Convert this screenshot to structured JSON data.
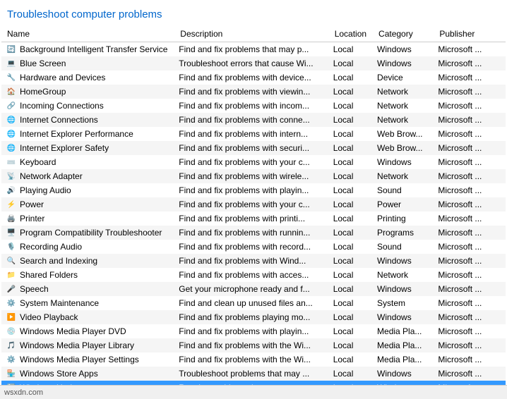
{
  "title": "Troubleshoot computer problems",
  "columns": [
    {
      "key": "name",
      "label": "Name"
    },
    {
      "key": "description",
      "label": "Description"
    },
    {
      "key": "location",
      "label": "Location"
    },
    {
      "key": "category",
      "label": "Category"
    },
    {
      "key": "publisher",
      "label": "Publisher"
    }
  ],
  "rows": [
    {
      "name": "Background Intelligent Transfer Service",
      "description": "Find and fix problems that may p...",
      "location": "Local",
      "category": "Windows",
      "publisher": "Microsoft ...",
      "icon": "bits",
      "selected": false
    },
    {
      "name": "Blue Screen",
      "description": "Troubleshoot errors that cause Wi...",
      "location": "Local",
      "category": "Windows",
      "publisher": "Microsoft ...",
      "icon": "bsod",
      "selected": false
    },
    {
      "name": "Hardware and Devices",
      "description": "Find and fix problems with device...",
      "location": "Local",
      "category": "Device",
      "publisher": "Microsoft ...",
      "icon": "hw",
      "selected": false
    },
    {
      "name": "HomeGroup",
      "description": "Find and fix problems with viewin...",
      "location": "Local",
      "category": "Network",
      "publisher": "Microsoft ...",
      "icon": "hg",
      "selected": false
    },
    {
      "name": "Incoming Connections",
      "description": "Find and fix problems with incom...",
      "location": "Local",
      "category": "Network",
      "publisher": "Microsoft ...",
      "icon": "ic",
      "selected": false
    },
    {
      "name": "Internet Connections",
      "description": "Find and fix problems with conne...",
      "location": "Local",
      "category": "Network",
      "publisher": "Microsoft ...",
      "icon": "inet",
      "selected": false
    },
    {
      "name": "Internet Explorer Performance",
      "description": "Find and fix problems with intern...",
      "location": "Local",
      "category": "Web Brow...",
      "publisher": "Microsoft ...",
      "icon": "ie",
      "selected": false
    },
    {
      "name": "Internet Explorer Safety",
      "description": "Find and fix problems with securi...",
      "location": "Local",
      "category": "Web Brow...",
      "publisher": "Microsoft ...",
      "icon": "ie",
      "selected": false
    },
    {
      "name": "Keyboard",
      "description": "Find and fix problems with your c...",
      "location": "Local",
      "category": "Windows",
      "publisher": "Microsoft ...",
      "icon": "key",
      "selected": false
    },
    {
      "name": "Network Adapter",
      "description": "Find and fix problems with wirele...",
      "location": "Local",
      "category": "Network",
      "publisher": "Microsoft ...",
      "icon": "net",
      "selected": false
    },
    {
      "name": "Playing Audio",
      "description": "Find and fix problems with playin...",
      "location": "Local",
      "category": "Sound",
      "publisher": "Microsoft ...",
      "icon": "audio",
      "selected": false
    },
    {
      "name": "Power",
      "description": "Find and fix problems with your c...",
      "location": "Local",
      "category": "Power",
      "publisher": "Microsoft ...",
      "icon": "power",
      "selected": false
    },
    {
      "name": "Printer",
      "description": "Find and fix problems with printi...",
      "location": "Local",
      "category": "Printing",
      "publisher": "Microsoft ...",
      "icon": "print",
      "selected": false
    },
    {
      "name": "Program Compatibility Troubleshooter",
      "description": "Find and fix problems with runnin...",
      "location": "Local",
      "category": "Programs",
      "publisher": "Microsoft ...",
      "icon": "compat",
      "selected": false
    },
    {
      "name": "Recording Audio",
      "description": "Find and fix problems with record...",
      "location": "Local",
      "category": "Sound",
      "publisher": "Microsoft ...",
      "icon": "rec",
      "selected": false
    },
    {
      "name": "Search and Indexing",
      "description": "Find and fix problems with Wind...",
      "location": "Local",
      "category": "Windows",
      "publisher": "Microsoft ...",
      "icon": "search",
      "selected": false
    },
    {
      "name": "Shared Folders",
      "description": "Find and fix problems with acces...",
      "location": "Local",
      "category": "Network",
      "publisher": "Microsoft ...",
      "icon": "shared",
      "selected": false
    },
    {
      "name": "Speech",
      "description": "Get your microphone ready and f...",
      "location": "Local",
      "category": "Windows",
      "publisher": "Microsoft ...",
      "icon": "speech",
      "selected": false
    },
    {
      "name": "System Maintenance",
      "description": "Find and clean up unused files an...",
      "location": "Local",
      "category": "System",
      "publisher": "Microsoft ...",
      "icon": "sys",
      "selected": false
    },
    {
      "name": "Video Playback",
      "description": "Find and fix problems playing mo...",
      "location": "Local",
      "category": "Windows",
      "publisher": "Microsoft ...",
      "icon": "video",
      "selected": false
    },
    {
      "name": "Windows Media Player DVD",
      "description": "Find and fix problems with playin...",
      "location": "Local",
      "category": "Media Pla...",
      "publisher": "Microsoft ...",
      "icon": "dvd",
      "selected": false
    },
    {
      "name": "Windows Media Player Library",
      "description": "Find and fix problems with the Wi...",
      "location": "Local",
      "category": "Media Pla...",
      "publisher": "Microsoft ...",
      "icon": "wmp",
      "selected": false
    },
    {
      "name": "Windows Media Player Settings",
      "description": "Find and fix problems with the Wi...",
      "location": "Local",
      "category": "Media Pla...",
      "publisher": "Microsoft ...",
      "icon": "wmpset",
      "selected": false
    },
    {
      "name": "Windows Store Apps",
      "description": "Troubleshoot problems that may ...",
      "location": "Local",
      "category": "Windows",
      "publisher": "Microsoft ...",
      "icon": "store",
      "selected": false
    },
    {
      "name": "Windows Update",
      "description": "Resolve problems that prevent yo...",
      "location": "Local",
      "category": "Windows",
      "publisher": "Microsoft ...",
      "icon": "wu",
      "selected": true
    }
  ],
  "footer": "wsxdn.com"
}
